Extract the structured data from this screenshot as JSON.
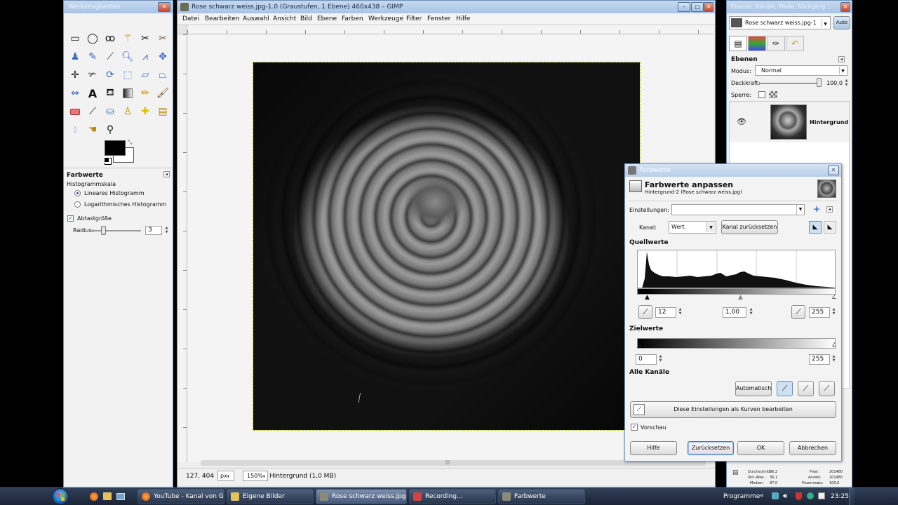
{
  "toolbox": {
    "title": "Werkzeugkasten",
    "section_title": "Farbwerte",
    "histogram_scale_label": "Histogrammskala",
    "linear_label": "Lineares Histogramm",
    "log_label": "Logarithmisches Histogramm",
    "sample_size_label": "Abtastgröße",
    "radius_label": "Radius:",
    "radius_value": "3"
  },
  "main_window": {
    "title": "Rose schwarz weiss.jpg-1.0 (Graustufen, 1 Ebene) 460x438 – GIMP",
    "menu": [
      "Datei",
      "Bearbeiten",
      "Auswahl",
      "Ansicht",
      "Bild",
      "Ebene",
      "Farben",
      "Werkzeuge",
      "Filter",
      "Fenster",
      "Hilfe"
    ],
    "status_coords": "127, 404",
    "status_unit": "px",
    "status_zoom": "150%",
    "status_info": "Hintergrund (1,0 MB)"
  },
  "layers_panel": {
    "title": "Ebenen, Kanäle, Pfade, Rückgäng...",
    "image_select": "Rose schwarz weiss.jpg-1",
    "auto_label": "Auto",
    "section_title": "Ebenen",
    "mode_label": "Modus:",
    "mode_value": "Normal",
    "opacity_label": "Deckkraft:",
    "opacity_value": "100,0",
    "lock_label": "Sperre:",
    "layer_name": "Hintergrund",
    "stats": {
      "mean_label": "Durchschnitt:",
      "mean_value": "86,2",
      "std_label": "Std.-Abw.:",
      "std_value": "36,1",
      "median_label": "Median:",
      "median_value": "87,0",
      "pixels_label": "Pixel:",
      "pixels_value": "201480",
      "count_label": "Anzahl:",
      "count_value": "201480",
      "percent_label": "Prozentsatz:",
      "percent_value": "100,0"
    }
  },
  "levels_dialog": {
    "window_title": "Farbwerte",
    "heading": "Farbwerte anpassen",
    "subheading": "Hintergrund-2 (Rose schwarz weiss.jpg)",
    "settings_label": "Einstellungen:",
    "settings_value": "",
    "channel_label": "Kanal:",
    "channel_value": "Wert",
    "reset_channel_label": "Kanal zurücksetzen",
    "input_levels_label": "Quellwerte",
    "input_low": "12",
    "input_gamma": "1,00",
    "input_high": "255",
    "output_levels_label": "Zielwerte",
    "output_low": "0",
    "output_high": "255",
    "all_channels_label": "Alle Kanäle",
    "auto_label": "Automatisch",
    "edit_curves_label": "Diese Einstellungen als Kurven bearbeiten",
    "preview_label": "Vorschau",
    "help_label": "Hilfe",
    "reset_label": "Zurücksetzen",
    "ok_label": "OK",
    "cancel_label": "Abbrechen"
  },
  "taskbar": {
    "items": [
      "YouTube - Kanal von G...",
      "Eigene Bilder",
      "Rose schwarz weiss.jpg...",
      "Recording...",
      "Farbwerte"
    ],
    "programs_label": "Programme",
    "clock": "23:25"
  },
  "colors": {
    "accent": "#9bb9df",
    "taskbar": "#1d2a3d",
    "window_bg": "#f0f0f0"
  }
}
